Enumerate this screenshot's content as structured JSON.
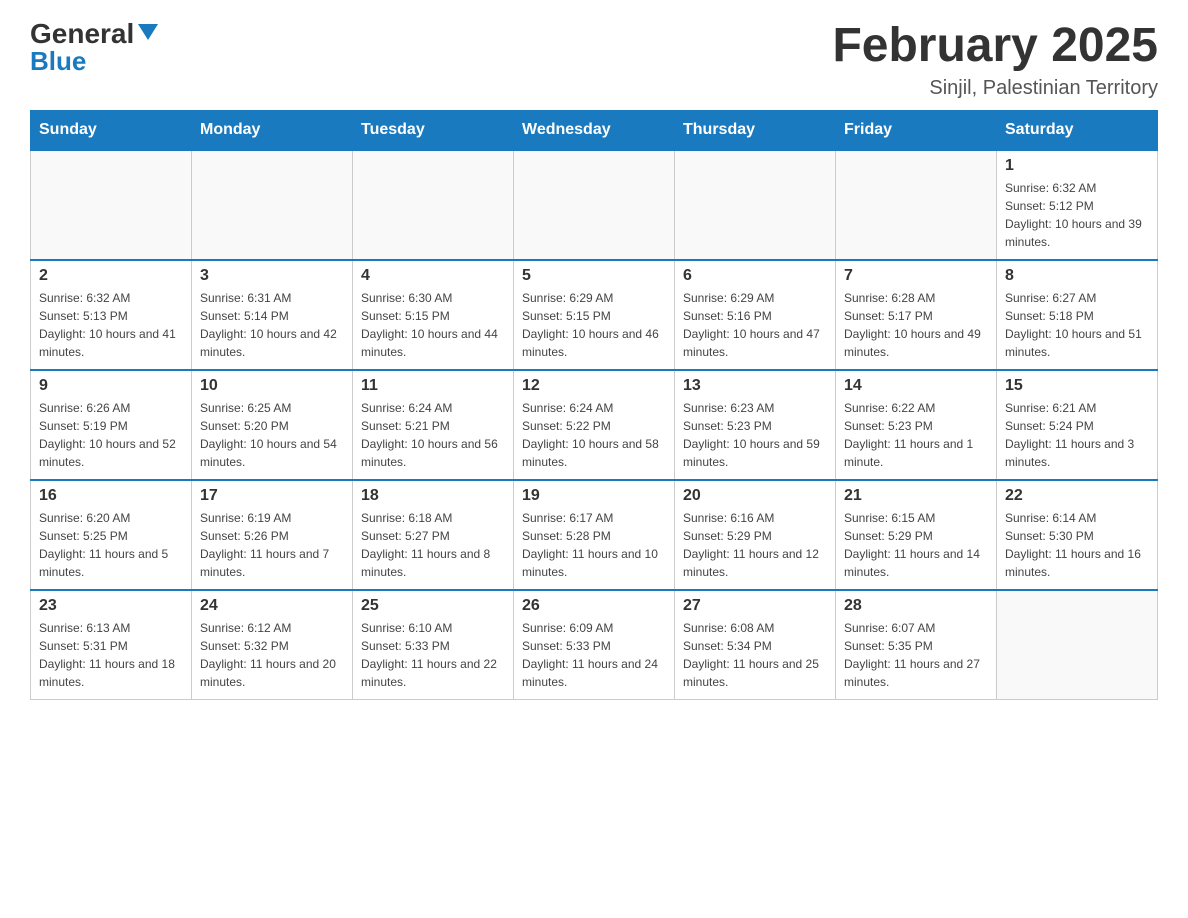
{
  "header": {
    "logo_general": "General",
    "logo_blue": "Blue",
    "month_title": "February 2025",
    "location": "Sinjil, Palestinian Territory"
  },
  "weekdays": [
    "Sunday",
    "Monday",
    "Tuesday",
    "Wednesday",
    "Thursday",
    "Friday",
    "Saturday"
  ],
  "weeks": [
    [
      {
        "day": "",
        "info": ""
      },
      {
        "day": "",
        "info": ""
      },
      {
        "day": "",
        "info": ""
      },
      {
        "day": "",
        "info": ""
      },
      {
        "day": "",
        "info": ""
      },
      {
        "day": "",
        "info": ""
      },
      {
        "day": "1",
        "info": "Sunrise: 6:32 AM\nSunset: 5:12 PM\nDaylight: 10 hours and 39 minutes."
      }
    ],
    [
      {
        "day": "2",
        "info": "Sunrise: 6:32 AM\nSunset: 5:13 PM\nDaylight: 10 hours and 41 minutes."
      },
      {
        "day": "3",
        "info": "Sunrise: 6:31 AM\nSunset: 5:14 PM\nDaylight: 10 hours and 42 minutes."
      },
      {
        "day": "4",
        "info": "Sunrise: 6:30 AM\nSunset: 5:15 PM\nDaylight: 10 hours and 44 minutes."
      },
      {
        "day": "5",
        "info": "Sunrise: 6:29 AM\nSunset: 5:15 PM\nDaylight: 10 hours and 46 minutes."
      },
      {
        "day": "6",
        "info": "Sunrise: 6:29 AM\nSunset: 5:16 PM\nDaylight: 10 hours and 47 minutes."
      },
      {
        "day": "7",
        "info": "Sunrise: 6:28 AM\nSunset: 5:17 PM\nDaylight: 10 hours and 49 minutes."
      },
      {
        "day": "8",
        "info": "Sunrise: 6:27 AM\nSunset: 5:18 PM\nDaylight: 10 hours and 51 minutes."
      }
    ],
    [
      {
        "day": "9",
        "info": "Sunrise: 6:26 AM\nSunset: 5:19 PM\nDaylight: 10 hours and 52 minutes."
      },
      {
        "day": "10",
        "info": "Sunrise: 6:25 AM\nSunset: 5:20 PM\nDaylight: 10 hours and 54 minutes."
      },
      {
        "day": "11",
        "info": "Sunrise: 6:24 AM\nSunset: 5:21 PM\nDaylight: 10 hours and 56 minutes."
      },
      {
        "day": "12",
        "info": "Sunrise: 6:24 AM\nSunset: 5:22 PM\nDaylight: 10 hours and 58 minutes."
      },
      {
        "day": "13",
        "info": "Sunrise: 6:23 AM\nSunset: 5:23 PM\nDaylight: 10 hours and 59 minutes."
      },
      {
        "day": "14",
        "info": "Sunrise: 6:22 AM\nSunset: 5:23 PM\nDaylight: 11 hours and 1 minute."
      },
      {
        "day": "15",
        "info": "Sunrise: 6:21 AM\nSunset: 5:24 PM\nDaylight: 11 hours and 3 minutes."
      }
    ],
    [
      {
        "day": "16",
        "info": "Sunrise: 6:20 AM\nSunset: 5:25 PM\nDaylight: 11 hours and 5 minutes."
      },
      {
        "day": "17",
        "info": "Sunrise: 6:19 AM\nSunset: 5:26 PM\nDaylight: 11 hours and 7 minutes."
      },
      {
        "day": "18",
        "info": "Sunrise: 6:18 AM\nSunset: 5:27 PM\nDaylight: 11 hours and 8 minutes."
      },
      {
        "day": "19",
        "info": "Sunrise: 6:17 AM\nSunset: 5:28 PM\nDaylight: 11 hours and 10 minutes."
      },
      {
        "day": "20",
        "info": "Sunrise: 6:16 AM\nSunset: 5:29 PM\nDaylight: 11 hours and 12 minutes."
      },
      {
        "day": "21",
        "info": "Sunrise: 6:15 AM\nSunset: 5:29 PM\nDaylight: 11 hours and 14 minutes."
      },
      {
        "day": "22",
        "info": "Sunrise: 6:14 AM\nSunset: 5:30 PM\nDaylight: 11 hours and 16 minutes."
      }
    ],
    [
      {
        "day": "23",
        "info": "Sunrise: 6:13 AM\nSunset: 5:31 PM\nDaylight: 11 hours and 18 minutes."
      },
      {
        "day": "24",
        "info": "Sunrise: 6:12 AM\nSunset: 5:32 PM\nDaylight: 11 hours and 20 minutes."
      },
      {
        "day": "25",
        "info": "Sunrise: 6:10 AM\nSunset: 5:33 PM\nDaylight: 11 hours and 22 minutes."
      },
      {
        "day": "26",
        "info": "Sunrise: 6:09 AM\nSunset: 5:33 PM\nDaylight: 11 hours and 24 minutes."
      },
      {
        "day": "27",
        "info": "Sunrise: 6:08 AM\nSunset: 5:34 PM\nDaylight: 11 hours and 25 minutes."
      },
      {
        "day": "28",
        "info": "Sunrise: 6:07 AM\nSunset: 5:35 PM\nDaylight: 11 hours and 27 minutes."
      },
      {
        "day": "",
        "info": ""
      }
    ]
  ]
}
